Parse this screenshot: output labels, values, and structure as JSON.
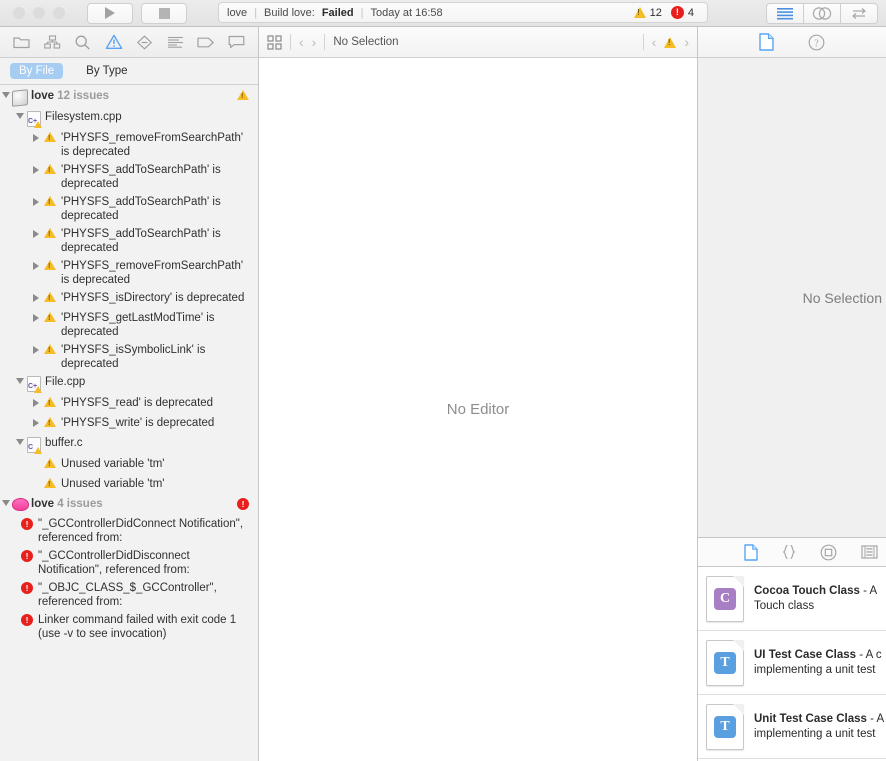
{
  "window": {
    "traffic_lights": [
      "close",
      "minimize",
      "zoom"
    ],
    "run_button": "run-icon",
    "stop_button": "stop-icon"
  },
  "status": {
    "scheme": "love",
    "separator": "|",
    "build_prefix": "Build love:",
    "build_result": "Failed",
    "time": "Today at 16:58",
    "warning_count": "12",
    "error_count": "4",
    "warning_glyph": "!",
    "error_glyph": "!"
  },
  "toolbar_right": {
    "items": [
      {
        "name": "standard-editor-button",
        "icon": "lines-icon"
      },
      {
        "name": "assistant-editor-button",
        "icon": "venn-icon"
      },
      {
        "name": "version-editor-button",
        "icon": "arrows-icon"
      }
    ]
  },
  "navigator": {
    "toolbar": [
      {
        "name": "project-navigator-tab",
        "icon": "folder-icon",
        "selected": false
      },
      {
        "name": "source-control-navigator-tab",
        "icon": "hierarchy-icon",
        "selected": false
      },
      {
        "name": "find-navigator-tab",
        "icon": "search-icon",
        "selected": false
      },
      {
        "name": "issue-navigator-tab",
        "icon": "warning-triangle-icon",
        "selected": true
      },
      {
        "name": "test-navigator-tab",
        "icon": "diamond-icon",
        "selected": false
      },
      {
        "name": "debug-navigator-tab",
        "icon": "list-icon",
        "selected": false
      },
      {
        "name": "breakpoint-navigator-tab",
        "icon": "tag-icon",
        "selected": false
      },
      {
        "name": "report-navigator-tab",
        "icon": "speech-bubble-icon",
        "selected": false
      }
    ],
    "filters": [
      {
        "label": "By File",
        "active": true
      },
      {
        "label": "By Type",
        "active": false
      }
    ],
    "groups": [
      {
        "name": "project-group",
        "icon": "project-icon",
        "title": "love",
        "subtitle": "12 issues",
        "badge": "warning",
        "expanded": true,
        "files": [
          {
            "name": "Filesystem.cpp",
            "icon": "cpp-file-icon",
            "expanded": true,
            "issues": [
              {
                "text": "'PHYSFS_removeFromSearchPath' is deprecated",
                "kind": "warning",
                "expandable": true
              },
              {
                "text": "'PHYSFS_addToSearchPath' is deprecated",
                "kind": "warning",
                "expandable": true
              },
              {
                "text": "'PHYSFS_addToSearchPath' is deprecated",
                "kind": "warning",
                "expandable": true
              },
              {
                "text": "'PHYSFS_addToSearchPath' is deprecated",
                "kind": "warning",
                "expandable": true
              },
              {
                "text": "'PHYSFS_removeFromSearchPath' is deprecated",
                "kind": "warning",
                "expandable": true
              },
              {
                "text": "'PHYSFS_isDirectory' is deprecated",
                "kind": "warning",
                "expandable": true
              },
              {
                "text": "'PHYSFS_getLastModTime' is deprecated",
                "kind": "warning",
                "expandable": true
              },
              {
                "text": "'PHYSFS_isSymbolicLink' is deprecated",
                "kind": "warning",
                "expandable": true
              }
            ]
          },
          {
            "name": "File.cpp",
            "icon": "cpp-file-icon",
            "expanded": true,
            "issues": [
              {
                "text": "'PHYSFS_read' is deprecated",
                "kind": "warning",
                "expandable": true
              },
              {
                "text": "'PHYSFS_write' is deprecated",
                "kind": "warning",
                "expandable": true
              }
            ]
          },
          {
            "name": "buffer.c",
            "icon": "c-file-icon",
            "expanded": true,
            "issues": [
              {
                "text": "Unused variable 'tm'",
                "kind": "warning",
                "expandable": false
              },
              {
                "text": "Unused variable 'tm'",
                "kind": "warning",
                "expandable": false
              }
            ]
          }
        ]
      },
      {
        "name": "target-group",
        "icon": "love-target-icon",
        "title": "love",
        "subtitle": "4 issues",
        "badge": "error",
        "expanded": true,
        "issues": [
          {
            "text": "\"_GCControllerDidConnect Notification\", referenced from:",
            "kind": "error"
          },
          {
            "text": "\"_GCControllerDidDisconnect Notification\", referenced from:",
            "kind": "error"
          },
          {
            "text": "\"_OBJC_CLASS_$_GCController\", referenced from:",
            "kind": "error"
          },
          {
            "text": "Linker command failed with exit code 1 (use -v to see invocation)",
            "kind": "error"
          }
        ]
      }
    ]
  },
  "editor": {
    "jumpbar": {
      "related_items_icon": "grid-icon",
      "back_label": "‹",
      "forward_label": "›",
      "path_label": "No Selection",
      "issue_prev": "‹",
      "issue_next": "›",
      "issue_icon": "warning-triangle-icon"
    },
    "placeholder": "No Editor"
  },
  "utility": {
    "inspector_tabs": [
      {
        "name": "file-inspector-tab",
        "icon": "document-icon",
        "selected": true
      },
      {
        "name": "quick-help-inspector-tab",
        "icon": "question-circle-icon",
        "selected": false
      }
    ],
    "inspector_placeholder": "No Selection",
    "library_tabs": [
      {
        "name": "file-template-library-tab",
        "icon": "document-icon",
        "selected": true
      },
      {
        "name": "code-snippet-library-tab",
        "icon": "braces-icon",
        "selected": false
      },
      {
        "name": "object-library-tab",
        "icon": "circle-target-icon",
        "selected": false
      },
      {
        "name": "media-library-tab",
        "icon": "media-icon",
        "selected": false
      }
    ],
    "library_items": [
      {
        "title": "Cocoa Touch Class",
        "dash": " - A ",
        "desc_tail": "Touch class",
        "badge_letter": "C",
        "badge_color": "#a87fc4"
      },
      {
        "title": "UI Test Case Class",
        "dash": " - A c",
        "desc_tail": "implementing a unit test",
        "badge_letter": "T",
        "badge_color": "#5a9fe0"
      },
      {
        "title": "Unit Test Case Class",
        "dash": " - A",
        "desc_tail": "implementing a unit test",
        "badge_letter": "T",
        "badge_color": "#5a9fe0"
      }
    ]
  },
  "colors": {
    "warning": "#f5bc25",
    "error": "#e8201d",
    "accent": "#4a90e2",
    "selected_pill": "#a6ccf2"
  }
}
